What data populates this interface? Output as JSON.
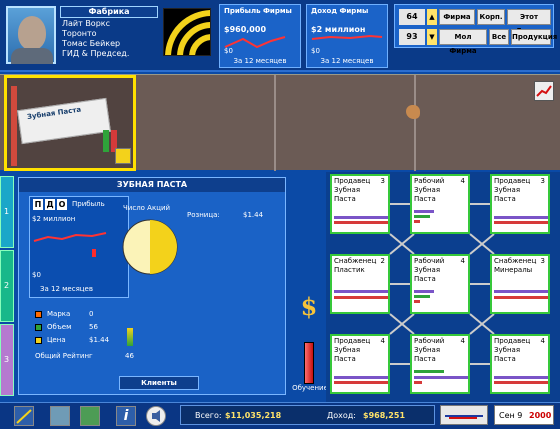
{
  "company": {
    "header": "Фабрика",
    "lines": [
      "Лайт Воркс",
      "Торонто",
      "Томас Бейкер",
      "ГИД & Председ."
    ]
  },
  "stats": {
    "profit_title": "Прибыль Фирмы",
    "profit_value": "$960,000",
    "profit_zero": "$0",
    "profit_footer": "За 12 месяцев",
    "income_title": "Доход Фирмы",
    "income_value": "$2 миллион",
    "income_zero": "$0",
    "income_footer": "За 12 месяцев"
  },
  "top_buttons": {
    "num1": "64",
    "num2": "93",
    "firm": "Фирма",
    "corp": "Корп.",
    "this_city": "Этот Город",
    "my_firm": "Мол Фирма",
    "all": "Все",
    "products": "Продукция"
  },
  "left_tabs": [
    "1",
    "2",
    "3"
  ],
  "product": {
    "title": "ЗУБНАЯ ПАСТА",
    "pdo": [
      "П",
      "Д",
      "О"
    ],
    "profit_label": "Прибыль",
    "shares_label": "Число Акций",
    "value_label": "$2 миллион",
    "zero_label": "$0",
    "period": "За 12 месяцев",
    "retail_label": "Розница:",
    "retail_value": "$1.44",
    "brand_label": "Марка",
    "brand_value": "0",
    "volume_label": "Объем",
    "volume_value": "56",
    "price_label": "Цена",
    "price_value": "$1.44",
    "rating_label": "Общий Рейтинг",
    "rating_value": "46",
    "clients_button": "Клиенты",
    "pack_label": "Зубная Паста"
  },
  "training": {
    "label": "Обучение"
  },
  "grid": [
    {
      "role": "Продавец",
      "num": "3",
      "l1": "Зубная",
      "l2": "Паста"
    },
    {
      "role": "Рабочий",
      "num": "4",
      "l1": "Зубная",
      "l2": "Паста"
    },
    {
      "role": "Продавец",
      "num": "3",
      "l1": "Зубная",
      "l2": "Паста"
    },
    {
      "role": "Снабженец",
      "num": "2",
      "l1": "Пластик",
      "l2": ""
    },
    {
      "role": "Рабочий",
      "num": "4",
      "l1": "Зубная",
      "l2": "Паста"
    },
    {
      "role": "Снабженец",
      "num": "3",
      "l1": "Минералы",
      "l2": ""
    },
    {
      "role": "Продавец",
      "num": "4",
      "l1": "Зубная",
      "l2": "Паста"
    },
    {
      "role": "Рабочий",
      "num": "4",
      "l1": "Зубная",
      "l2": "Паста"
    },
    {
      "role": "Продавец",
      "num": "4",
      "l1": "Зубная",
      "l2": "Паста"
    }
  ],
  "bottom": {
    "total_label": "Всего:",
    "total_value": "$11,035,218",
    "income_label": "Доход:",
    "income_value": "$968,251",
    "month": "Сен 9",
    "year": "2000"
  },
  "icons": [
    "chart-icon",
    "map-icon",
    "world-icon",
    "info-icon",
    "speaker-icon",
    "dollar-icon"
  ]
}
